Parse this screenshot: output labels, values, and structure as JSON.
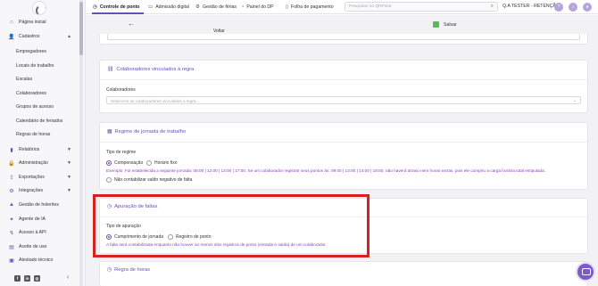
{
  "sidebar": {
    "items": [
      {
        "label": "Página inicial",
        "icon": "home-icon"
      },
      {
        "label": "Cadastros",
        "icon": "users-icon",
        "expanded": true
      },
      {
        "label": "Relatórios",
        "icon": "report-icon"
      },
      {
        "label": "Administração",
        "icon": "lock-icon"
      },
      {
        "label": "Exportações",
        "icon": "export-icon"
      },
      {
        "label": "Integrações",
        "icon": "integration-icon"
      },
      {
        "label": "Gestão de holerites",
        "icon": "payslip-icon"
      },
      {
        "label": "Agente de IA",
        "icon": "ai-icon"
      },
      {
        "label": "Acesso à API",
        "icon": "api-icon"
      },
      {
        "label": "Aceite de uso",
        "icon": "accept-icon"
      },
      {
        "label": "Atestado técnico",
        "icon": "certificate-icon"
      }
    ],
    "subitems": [
      "Empregadores",
      "Locais de trabalho",
      "Escalas",
      "Colaboradores",
      "Grupos de acesso",
      "Calendário de feriados",
      "Regras de horas"
    ]
  },
  "topbar": {
    "tabs": [
      {
        "label": "Controle de ponto",
        "icon": "clock-icon",
        "active": true
      },
      {
        "label": "Admissão digital",
        "icon": "document-icon"
      },
      {
        "label": "Gestão de férias",
        "icon": "gear-icon"
      },
      {
        "label": "Painel do DP",
        "icon": "panel-icon"
      },
      {
        "label": "Folha de pagamento",
        "icon": "payroll-icon"
      }
    ],
    "search_placeholder": "Pesquisar no QRPoint",
    "user_name": "Q.A TESTER - RETENÇÃO"
  },
  "actions": {
    "back_label": "Voltar",
    "save_label": "Salvar"
  },
  "cards": {
    "colaboradores": {
      "title": "Colaboradores vinculados à regra",
      "field_label": "Colaboradores",
      "placeholder": "Selecione os colaboradores vinculados à regra..."
    },
    "regime": {
      "title": "Regime de jornada de trabalho",
      "field_label": "Tipo de regime",
      "options": [
        "Compensação",
        "Horário fixo"
      ],
      "selected": "Compensação",
      "example": "Exemplo: Foi estabelecida a seguinte jornada: 08:00 | 12:00 | 13:00 | 17:00. Se um colaborador registrar seus pontos às: 09:00 | 13:00 | 14:00 | 18:00, não haverá atraso nem horas extras, pois ele cumpriu a carga horária total estipulada.",
      "checkbox_label": "Não contabilizar saldo negativo de falta"
    },
    "faltas": {
      "title": "Apuração de faltas",
      "field_label": "Tipo de apuração",
      "options": [
        "Cumprimento de jornada",
        "Registro de ponto"
      ],
      "selected": "Cumprimento de jornada",
      "note": "A falta será contabilizada enquanto não houver ao menos dois registros de ponto (entrada e saída) de um colaborador."
    },
    "banco": {
      "title": "Regra de horas"
    }
  },
  "colors": {
    "accent": "#6a4fb3",
    "highlight_border": "#d9201f",
    "note_text": "#8a3fbf",
    "save": "#5cb85c"
  }
}
